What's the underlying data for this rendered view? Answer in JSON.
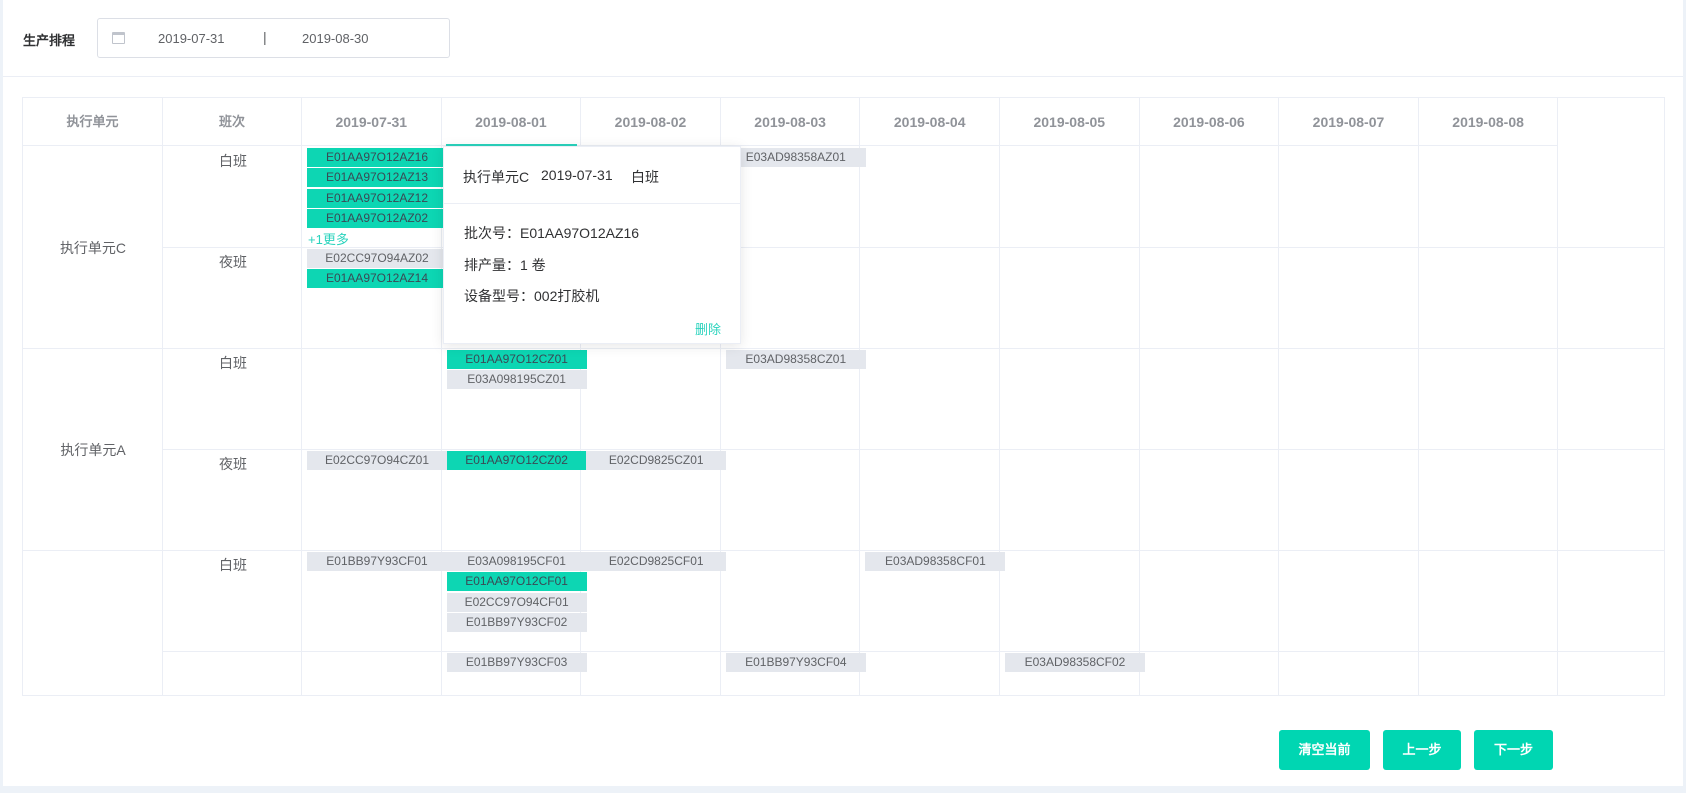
{
  "toolbar": {
    "label": "生产排程",
    "date_start": "2019-07-31",
    "date_sep": "|",
    "date_end": "2019-08-30"
  },
  "header": {
    "unit_col": "执行单元",
    "shift_col": "班次",
    "dates": [
      "2019-07-31",
      "2019-08-01",
      "2019-08-02",
      "2019-08-03",
      "2019-08-04",
      "2019-08-05",
      "2019-08-06",
      "2019-08-07",
      "2019-08-08"
    ]
  },
  "units": [
    {
      "name": "执行单元C",
      "shifts": [
        "白班",
        "夜班"
      ]
    },
    {
      "name": "执行单元A",
      "shifts": [
        "白班",
        "夜班"
      ]
    },
    {
      "name": "",
      "shifts": [
        "白班",
        ""
      ]
    }
  ],
  "chips": [
    {
      "row": 0,
      "col": 0,
      "slot": 0,
      "text": "E01AA97O12AZ16",
      "on": true
    },
    {
      "row": 0,
      "col": 0,
      "slot": 1,
      "text": "E01AA97O12AZ13",
      "on": true
    },
    {
      "row": 0,
      "col": 0,
      "slot": 2,
      "text": "E01AA97O12AZ12",
      "on": true
    },
    {
      "row": 0,
      "col": 0,
      "slot": 3,
      "text": "E01AA97O12AZ02",
      "on": true
    },
    {
      "row": 0,
      "col": 3,
      "slot": 0,
      "text": "E03AD98358AZ01",
      "on": false
    },
    {
      "row": 1,
      "col": 0,
      "slot": 0,
      "text": "E02CC97O94AZ02",
      "on": false
    },
    {
      "row": 1,
      "col": 0,
      "slot": 1,
      "text": "E01AA97O12AZ14",
      "on": true
    },
    {
      "row": 2,
      "col": 1,
      "slot": 0,
      "text": "E01AA97O12CZ01",
      "on": true
    },
    {
      "row": 2,
      "col": 1,
      "slot": 1,
      "text": "E03A098195CZ01",
      "on": false
    },
    {
      "row": 2,
      "col": 3,
      "slot": 0,
      "text": "E03AD98358CZ01",
      "on": false
    },
    {
      "row": 3,
      "col": 0,
      "slot": 0,
      "text": "E02CC97O94CZ01",
      "on": false
    },
    {
      "row": 3,
      "col": 1,
      "slot": 0,
      "text": "E01AA97O12CZ02",
      "on": true
    },
    {
      "row": 3,
      "col": 2,
      "slot": 0,
      "text": "E02CD9825CZ01",
      "on": false
    },
    {
      "row": 4,
      "col": 0,
      "slot": 0,
      "text": "E01BB97Y93CF01",
      "on": false
    },
    {
      "row": 4,
      "col": 1,
      "slot": 0,
      "text": "E03A098195CF01",
      "on": false
    },
    {
      "row": 4,
      "col": 1,
      "slot": 1,
      "text": "E01AA97O12CF01",
      "on": true
    },
    {
      "row": 4,
      "col": 1,
      "slot": 2,
      "text": "E02CC97O94CF01",
      "on": false
    },
    {
      "row": 4,
      "col": 1,
      "slot": 3,
      "text": "E01BB97Y93CF02",
      "on": false
    },
    {
      "row": 4,
      "col": 2,
      "slot": 0,
      "text": "E02CD9825CF01",
      "on": false
    },
    {
      "row": 4,
      "col": 4,
      "slot": 0,
      "text": "E03AD98358CF01",
      "on": false
    },
    {
      "row": 5,
      "col": 1,
      "slot": 0,
      "text": "E01BB97Y93CF03",
      "on": false
    },
    {
      "row": 5,
      "col": 3,
      "slot": 0,
      "text": "E01BB97Y93CF04",
      "on": false
    },
    {
      "row": 5,
      "col": 5,
      "slot": 0,
      "text": "E03AD98358CF02",
      "on": false
    }
  ],
  "more_link": "+1更多",
  "popover": {
    "unit": "执行单元C",
    "date": "2019-07-31",
    "shift": "白班",
    "batch": "批次号：E01AA97O12AZ16",
    "quantity": "排产量：1 卷",
    "device": "设备型号：002打胶机",
    "delete": "删除"
  },
  "buttons": {
    "clear": "清空当前",
    "prev": "上一步",
    "next": "下一步"
  }
}
